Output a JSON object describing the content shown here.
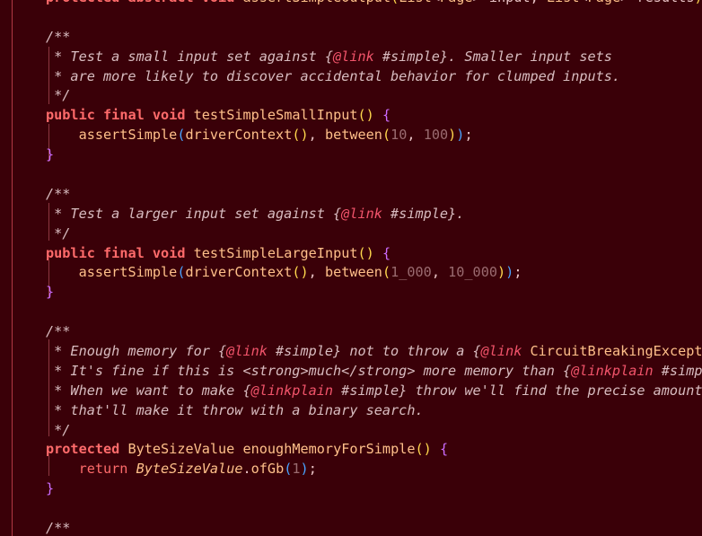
{
  "editor": {
    "lines": [
      [
        [
          "kw",
          "protected"
        ],
        [
          "ptext",
          " "
        ],
        [
          "kw",
          "abstract"
        ],
        [
          "ptext",
          " "
        ],
        [
          "kw",
          "void"
        ],
        [
          "ptext",
          " "
        ],
        [
          "method-decl",
          "assertSimpleOutput"
        ],
        [
          "paren1",
          "("
        ],
        [
          "type",
          "List"
        ],
        [
          "ptext",
          "<"
        ],
        [
          "type",
          "Page"
        ],
        [
          "ptext",
          "> input, "
        ],
        [
          "type",
          "List"
        ],
        [
          "ptext",
          "<"
        ],
        [
          "type",
          "Page"
        ],
        [
          "ptext",
          "> results"
        ],
        [
          "paren1",
          ")"
        ],
        [
          "ptext",
          ";"
        ]
      ],
      [
        [
          "ptext",
          ""
        ]
      ],
      [
        [
          "comment",
          "/**"
        ]
      ],
      [
        [
          "comment",
          " * Test a small input set against {"
        ],
        [
          "doc-tag",
          "@link"
        ],
        [
          "comment",
          " #simple}. Smaller input sets"
        ]
      ],
      [
        [
          "comment",
          " * are more likely to discover accidental behavior for clumped inputs."
        ]
      ],
      [
        [
          "comment",
          " */"
        ]
      ],
      [
        [
          "kw",
          "public"
        ],
        [
          "ptext",
          " "
        ],
        [
          "kw",
          "final"
        ],
        [
          "ptext",
          " "
        ],
        [
          "kw",
          "void"
        ],
        [
          "ptext",
          " "
        ],
        [
          "method-decl",
          "testSimpleSmallInput"
        ],
        [
          "paren1",
          "()"
        ],
        [
          "ptext",
          " "
        ],
        [
          "paren2",
          "{"
        ]
      ],
      [
        [
          "ptext",
          "    "
        ],
        [
          "call",
          "assertSimple"
        ],
        [
          "paren3",
          "("
        ],
        [
          "call",
          "driverContext"
        ],
        [
          "paren1",
          "()"
        ],
        [
          "ptext",
          ", "
        ],
        [
          "call",
          "between"
        ],
        [
          "paren1",
          "("
        ],
        [
          "num",
          "10"
        ],
        [
          "ptext",
          ", "
        ],
        [
          "num",
          "100"
        ],
        [
          "paren1",
          ")"
        ],
        [
          "paren3",
          ")"
        ],
        [
          "ptext",
          ";"
        ]
      ],
      [
        [
          "paren2",
          "}"
        ]
      ],
      [
        [
          "ptext",
          ""
        ]
      ],
      [
        [
          "comment",
          "/**"
        ]
      ],
      [
        [
          "comment",
          " * Test a larger input set against {"
        ],
        [
          "doc-tag",
          "@link"
        ],
        [
          "comment",
          " #simple}."
        ]
      ],
      [
        [
          "comment",
          " */"
        ]
      ],
      [
        [
          "kw",
          "public"
        ],
        [
          "ptext",
          " "
        ],
        [
          "kw",
          "final"
        ],
        [
          "ptext",
          " "
        ],
        [
          "kw",
          "void"
        ],
        [
          "ptext",
          " "
        ],
        [
          "method-decl",
          "testSimpleLargeInput"
        ],
        [
          "paren1",
          "()"
        ],
        [
          "ptext",
          " "
        ],
        [
          "paren2",
          "{"
        ]
      ],
      [
        [
          "ptext",
          "    "
        ],
        [
          "call",
          "assertSimple"
        ],
        [
          "paren3",
          "("
        ],
        [
          "call",
          "driverContext"
        ],
        [
          "paren1",
          "()"
        ],
        [
          "ptext",
          ", "
        ],
        [
          "call",
          "between"
        ],
        [
          "paren1",
          "("
        ],
        [
          "num",
          "1_000"
        ],
        [
          "ptext",
          ", "
        ],
        [
          "num",
          "10_000"
        ],
        [
          "paren1",
          ")"
        ],
        [
          "paren3",
          ")"
        ],
        [
          "ptext",
          ";"
        ]
      ],
      [
        [
          "paren2",
          "}"
        ]
      ],
      [
        [
          "ptext",
          ""
        ]
      ],
      [
        [
          "comment",
          "/**"
        ]
      ],
      [
        [
          "comment",
          " * Enough memory for {"
        ],
        [
          "doc-tag",
          "@link"
        ],
        [
          "comment",
          " #simple} not to throw a {"
        ],
        [
          "doc-tag",
          "@link"
        ],
        [
          "comment",
          " "
        ],
        [
          "type",
          "CircuitBreakingException"
        ],
        [
          "comment",
          "}."
        ]
      ],
      [
        [
          "comment",
          " * It's fine if this is <strong>much</strong> more memory than {"
        ],
        [
          "doc-tag",
          "@linkplain"
        ],
        [
          "comment",
          " #simple} needs."
        ]
      ],
      [
        [
          "comment",
          " * When we want to make {"
        ],
        [
          "doc-tag",
          "@linkplain"
        ],
        [
          "comment",
          " #simple} throw we'll find the precise amount of memory"
        ]
      ],
      [
        [
          "comment",
          " * that'll make it throw with a binary search."
        ]
      ],
      [
        [
          "comment",
          " */"
        ]
      ],
      [
        [
          "kw",
          "protected"
        ],
        [
          "ptext",
          " "
        ],
        [
          "type",
          "ByteSizeValue"
        ],
        [
          "ptext",
          " "
        ],
        [
          "method-decl",
          "enoughMemoryForSimple"
        ],
        [
          "paren1",
          "()"
        ],
        [
          "ptext",
          " "
        ],
        [
          "paren2",
          "{"
        ]
      ],
      [
        [
          "ptext",
          "    "
        ],
        [
          "kw-ret",
          "return"
        ],
        [
          "ptext",
          " "
        ],
        [
          "static-type",
          "ByteSizeValue"
        ],
        [
          "ptext",
          "."
        ],
        [
          "call",
          "ofGb"
        ],
        [
          "paren3",
          "("
        ],
        [
          "num",
          "1"
        ],
        [
          "paren3",
          ")"
        ],
        [
          "ptext",
          ";"
        ]
      ],
      [
        [
          "paren2",
          "}"
        ]
      ],
      [
        [
          "ptext",
          ""
        ]
      ],
      [
        [
          "comment",
          "/**"
        ]
      ]
    ]
  }
}
